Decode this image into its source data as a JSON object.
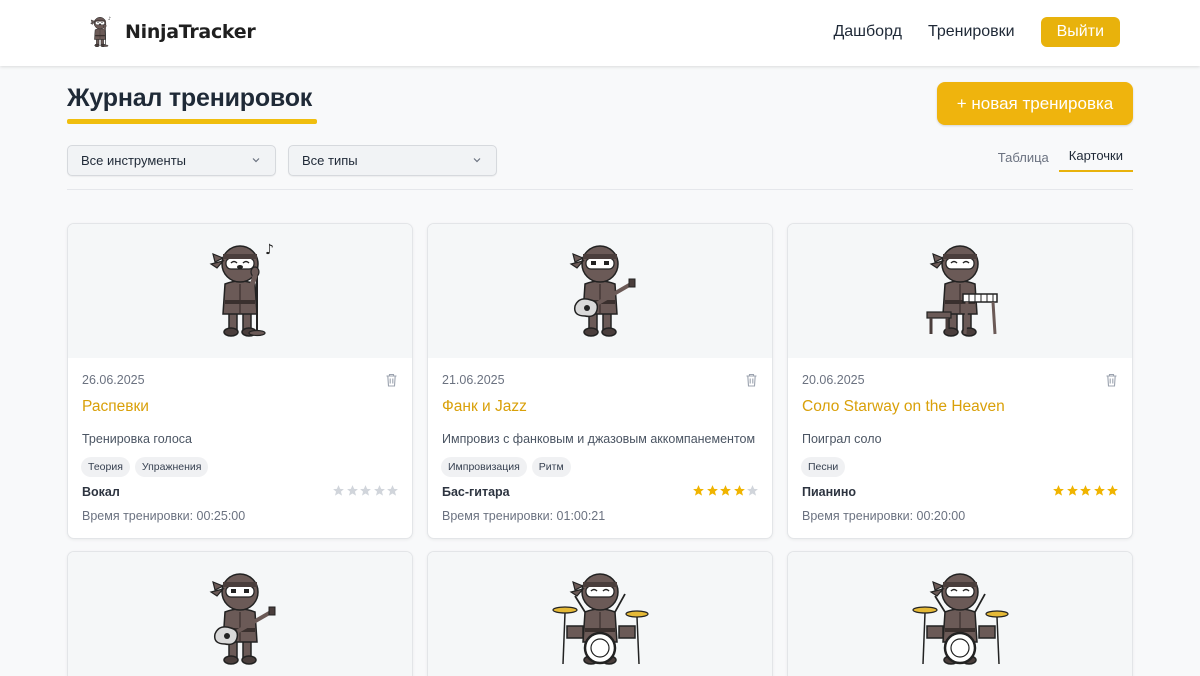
{
  "app": {
    "name": "NinjaTracker"
  },
  "nav": {
    "dashboard": "Дашборд",
    "trainings": "Тренировки",
    "logout": "Выйти"
  },
  "page": {
    "title": "Журнал тренировок",
    "new_button": "+ новая тренировка"
  },
  "filters": {
    "instrument": "Все инструменты",
    "type": "Все типы"
  },
  "view": {
    "table": "Таблица",
    "cards": "Карточки",
    "active": "cards"
  },
  "colors": {
    "accent": "#efb40d",
    "title_link": "#d9a009",
    "star_filled": "#f0b400",
    "star_empty": "#d1d5db"
  },
  "cards": [
    {
      "date": "26.06.2025",
      "title": "Распевки",
      "description": "Тренировка голоса",
      "tags": [
        "Теория",
        "Упражнения"
      ],
      "instrument": "Вокал",
      "rating": 0,
      "time_label": "Время тренировки:",
      "time": "00:25:00",
      "image": "ninja-singer"
    },
    {
      "date": "21.06.2025",
      "title": "Фанк и Jazz",
      "description": "Импровиз с фанковым и джазовым аккомпанементом",
      "tags": [
        "Импровизация",
        "Ритм"
      ],
      "instrument": "Бас-гитара",
      "rating": 4,
      "time_label": "Время тренировки:",
      "time": "01:00:21",
      "image": "ninja-bass"
    },
    {
      "date": "20.06.2025",
      "title": "Соло Starway on the Heaven",
      "description": "Поиграл соло",
      "tags": [
        "Песни"
      ],
      "instrument": "Пианино",
      "rating": 5,
      "time_label": "Время тренировки:",
      "time": "00:20:00",
      "image": "ninja-piano"
    },
    {
      "image": "ninja-bass"
    },
    {
      "image": "ninja-drums"
    },
    {
      "image": "ninja-drums"
    }
  ]
}
